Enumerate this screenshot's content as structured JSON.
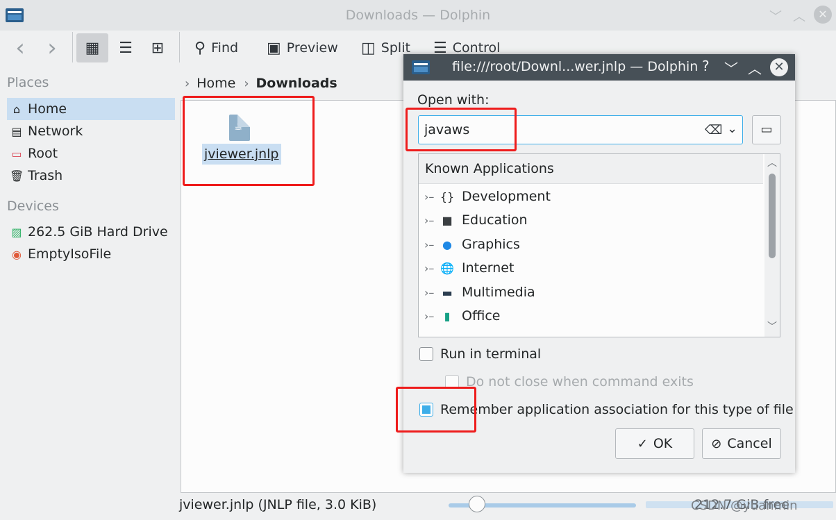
{
  "main_window": {
    "title": "Downloads — Dolphin",
    "toolbar": {
      "back_label": "‹",
      "forward_label": "›",
      "find_label": "Find",
      "preview_label": "Preview",
      "split_label": "Split",
      "control_label": "Control"
    },
    "sidebar": {
      "places_header": "Places",
      "places": [
        {
          "label": "Home",
          "icon": "home-icon",
          "selected": true
        },
        {
          "label": "Network",
          "icon": "network-icon"
        },
        {
          "label": "Root",
          "icon": "root-folder-icon"
        },
        {
          "label": "Trash",
          "icon": "trash-icon"
        }
      ],
      "devices_header": "Devices",
      "devices": [
        {
          "label": "262.5 GiB Hard Drive",
          "icon": "hard-drive-icon"
        },
        {
          "label": "EmptyIsoFile",
          "icon": "iso-file-icon"
        }
      ]
    },
    "breadcrumb": {
      "home": "Home",
      "current": "Downloads"
    },
    "file": {
      "name": "jviewer.jnlp",
      "icon": "java-file-icon"
    },
    "status": {
      "text": "jviewer.jnlp (JNLP file, 3.0 KiB)",
      "free_space": "212.7 GiB free",
      "watermark": "CSDN @yuanmin"
    }
  },
  "dialog": {
    "title": "file:///root/Downl...wer.jnlp — Dolphin",
    "open_with_label": "Open with:",
    "app_input_value": "javaws",
    "tree_header": "Known Applications",
    "categories": [
      {
        "label": "Development",
        "icon": "development-icon"
      },
      {
        "label": "Education",
        "icon": "education-icon"
      },
      {
        "label": "Graphics",
        "icon": "graphics-icon"
      },
      {
        "label": "Internet",
        "icon": "internet-icon"
      },
      {
        "label": "Multimedia",
        "icon": "multimedia-icon"
      },
      {
        "label": "Office",
        "icon": "office-icon"
      }
    ],
    "run_in_terminal": {
      "label": "Run in terminal",
      "checked": false
    },
    "do_not_close": {
      "label": "Do not close when command exits",
      "checked": false,
      "disabled": true
    },
    "remember": {
      "label": "Remember application association for this type of file",
      "checked": true
    },
    "ok_label": "OK",
    "cancel_label": "Cancel"
  },
  "colors": {
    "accent": "#3daee9",
    "selection": "#c9def2",
    "dialog_titlebar": "#475057",
    "annotation_red": "#ee1c1c"
  }
}
